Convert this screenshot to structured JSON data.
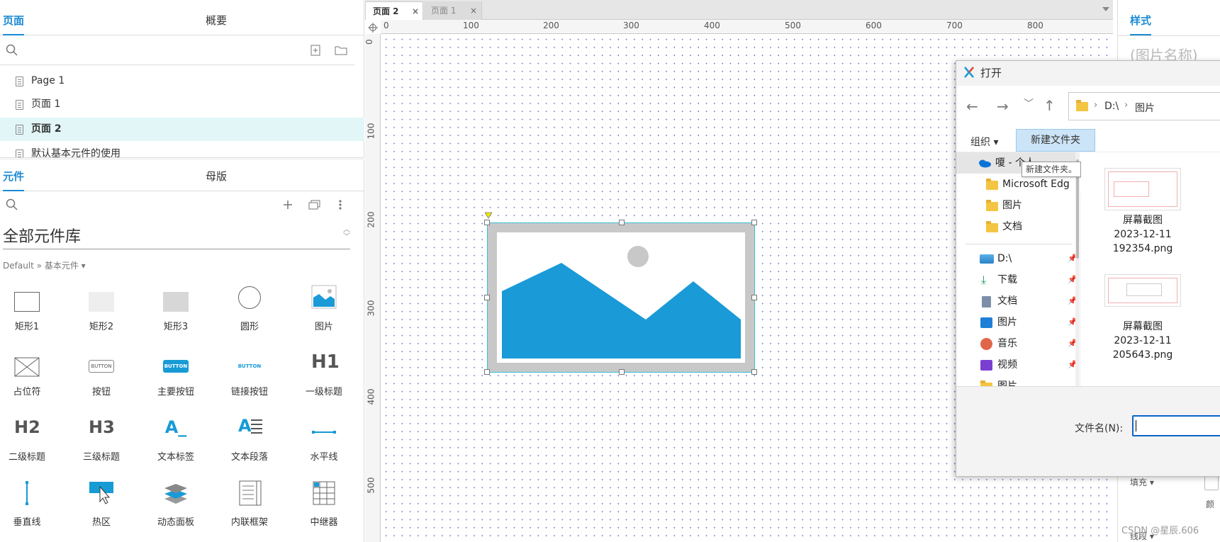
{
  "left_panel": {
    "top_tabs": {
      "pages": "页面",
      "outline": "概要"
    },
    "pages": [
      {
        "label": "Page 1",
        "selected": false
      },
      {
        "label": "页面 1",
        "selected": false
      },
      {
        "label": "页面 2",
        "selected": true
      },
      {
        "label": "默认基本元件的使用",
        "selected": false
      }
    ],
    "bottom_tabs": {
      "widgets": "元件",
      "masters": "母版"
    },
    "library_title": "全部元件库",
    "library_breadcrumb": "Default » 基本元件 ▾",
    "widgets": [
      {
        "label": "矩形1",
        "icon": "rect1-icon"
      },
      {
        "label": "矩形2",
        "icon": "rect2-icon"
      },
      {
        "label": "矩形3",
        "icon": "rect3-icon"
      },
      {
        "label": "圆形",
        "icon": "circle-icon"
      },
      {
        "label": "图片",
        "icon": "image-icon"
      },
      {
        "label": "占位符",
        "icon": "placeholder-icon"
      },
      {
        "label": "按钮",
        "icon": "button-icon",
        "text": "BUTTON"
      },
      {
        "label": "主要按钮",
        "icon": "primary-button-icon",
        "text": "BUTTON"
      },
      {
        "label": "链接按钮",
        "icon": "link-button-icon",
        "text": "BUTTON"
      },
      {
        "label": "一级标题",
        "icon": "h1-icon",
        "text": "H1"
      },
      {
        "label": "二级标题",
        "icon": "h2-icon",
        "text": "H2"
      },
      {
        "label": "三级标题",
        "icon": "h3-icon",
        "text": "H3"
      },
      {
        "label": "文本标签",
        "icon": "text-label-icon",
        "text": "A_"
      },
      {
        "label": "文本段落",
        "icon": "paragraph-icon",
        "text": "A"
      },
      {
        "label": "水平线",
        "icon": "horizontal-line-icon"
      },
      {
        "label": "垂直线",
        "icon": "vertical-line-icon"
      },
      {
        "label": "热区",
        "icon": "hotspot-icon"
      },
      {
        "label": "动态面板",
        "icon": "dynamic-panel-icon"
      },
      {
        "label": "内联框架",
        "icon": "inline-frame-icon"
      },
      {
        "label": "中继器",
        "icon": "repeater-icon"
      }
    ]
  },
  "canvas": {
    "tabs": [
      {
        "label": "页面 2",
        "active": true
      },
      {
        "label": "页面 1",
        "active": false
      }
    ],
    "h_ruler": [
      "0",
      "100",
      "200",
      "300",
      "400",
      "500",
      "600",
      "700",
      "800"
    ],
    "v_ruler": [
      "0",
      "100",
      "200",
      "300",
      "400",
      "500"
    ]
  },
  "right_panel": {
    "tab": "样式",
    "name_placeholder": "(图片名称)",
    "fill_label": "填充 ▾",
    "line_label": "线段 ▾",
    "color_label": "颜",
    "watermark": "CSDN @星辰.606"
  },
  "dialog": {
    "title": "打开",
    "path": [
      "D:\\",
      "图片"
    ],
    "organize": "组织 ▾",
    "new_folder": "新建文件夹",
    "tooltip": "新建文件夹。",
    "tree": [
      {
        "label": "嗄 - 个人",
        "icon": "onedrive-icon"
      },
      {
        "label": "Microsoft Edg",
        "icon": "folder-icon"
      },
      {
        "label": "图片",
        "icon": "folder-icon"
      },
      {
        "label": "文档",
        "icon": "folder-icon"
      },
      {
        "label": "D:\\",
        "icon": "drive-icon"
      },
      {
        "label": "下载",
        "icon": "download-icon"
      },
      {
        "label": "文档",
        "icon": "document-icon"
      },
      {
        "label": "图片",
        "icon": "pictures-icon"
      },
      {
        "label": "音乐",
        "icon": "music-icon"
      },
      {
        "label": "视频",
        "icon": "video-icon"
      },
      {
        "label": "图片",
        "icon": "folder-icon"
      }
    ],
    "files": [
      {
        "caption_lines": [
          "屏幕截图",
          "2023-12-11",
          "192354.png"
        ]
      },
      {
        "caption_lines": [
          "屏幕截图",
          "2023-12-11",
          "205643.png"
        ]
      }
    ],
    "filename_label": "文件名(N):",
    "filename_value": ""
  }
}
